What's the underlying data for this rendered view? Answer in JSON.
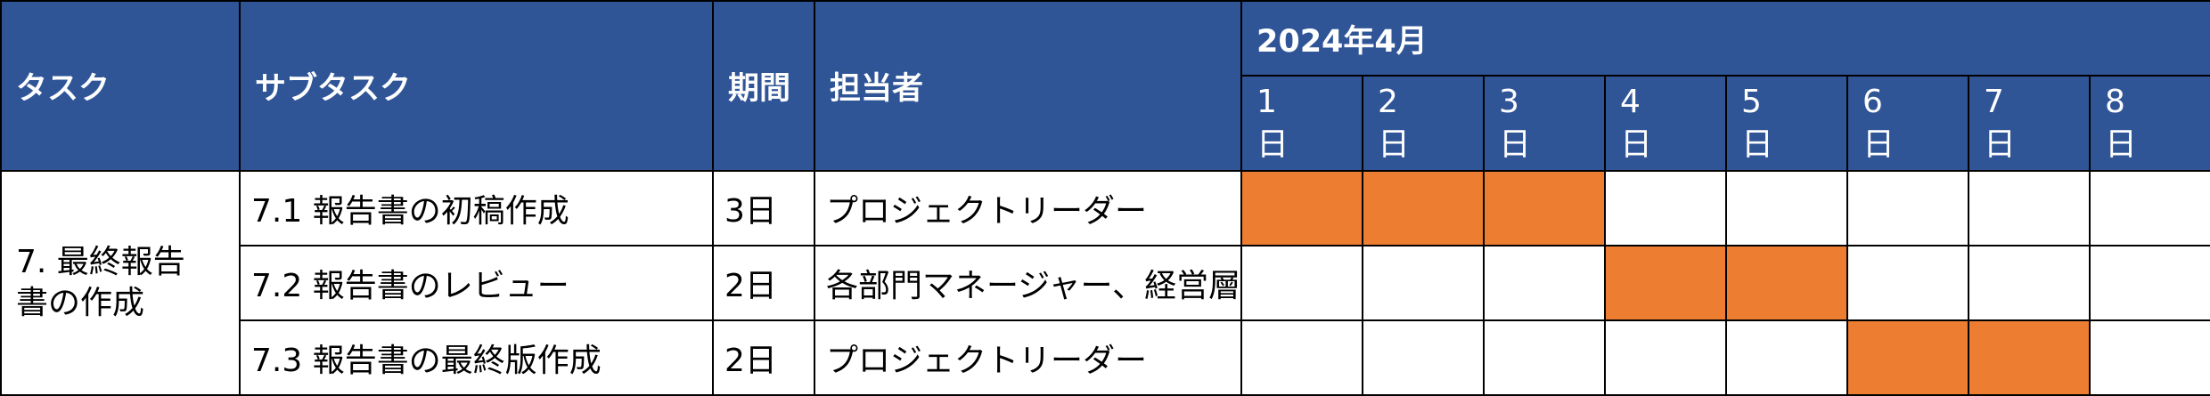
{
  "headers": {
    "task": "タスク",
    "subtask": "サブタスク",
    "duration": "期間",
    "owner": "担当者",
    "month": "2024年4月"
  },
  "days": [
    {
      "num": "1",
      "unit": "日"
    },
    {
      "num": "2",
      "unit": "日"
    },
    {
      "num": "3",
      "unit": "日"
    },
    {
      "num": "4",
      "unit": "日"
    },
    {
      "num": "5",
      "unit": "日"
    },
    {
      "num": "6",
      "unit": "日"
    },
    {
      "num": "7",
      "unit": "日"
    },
    {
      "num": "8",
      "unit": "日"
    }
  ],
  "task_name": "7. 最終報告書の作成",
  "rows": [
    {
      "subtask": "7.1 報告書の初稿作成",
      "duration": "3日",
      "owner": "プロジェクトリーダー"
    },
    {
      "subtask": "7.2 報告書のレビュー",
      "duration": "2日",
      "owner": "各部門マネージャー、経営層"
    },
    {
      "subtask": "7.3 報告書の最終版作成",
      "duration": "2日",
      "owner": "プロジェクトリーダー"
    }
  ],
  "colors": {
    "header_bg": "#2f5597",
    "bar_fill": "#ed7d31"
  },
  "chart_data": {
    "type": "table",
    "categories": [
      "1",
      "2",
      "3",
      "4",
      "5",
      "6",
      "7",
      "8"
    ],
    "series": [
      {
        "name": "7.1 報告書の初稿作成",
        "start_day": 1,
        "end_day": 3
      },
      {
        "name": "7.2 報告書のレビュー",
        "start_day": 4,
        "end_day": 5
      },
      {
        "name": "7.3 報告書の最終版作成",
        "start_day": 6,
        "end_day": 7
      }
    ]
  }
}
